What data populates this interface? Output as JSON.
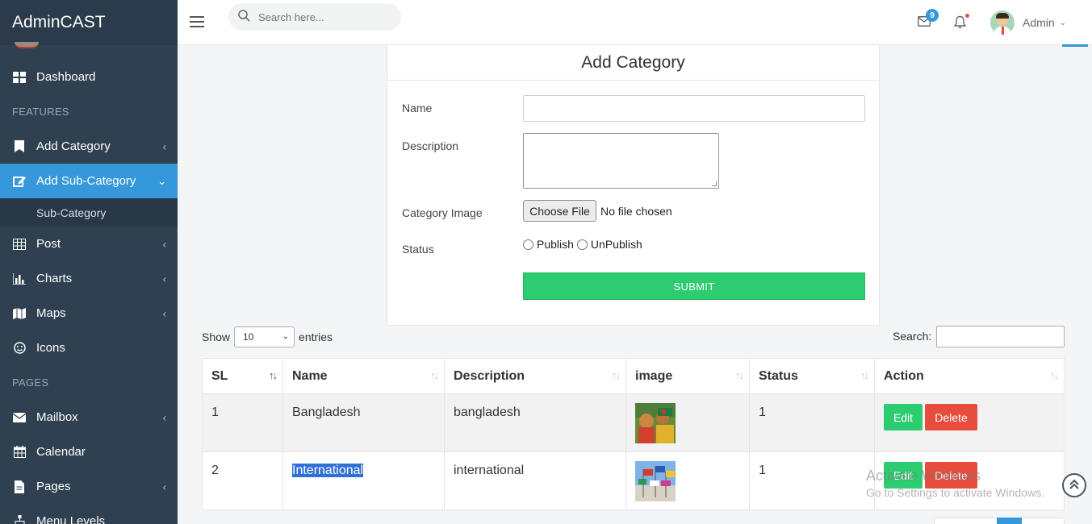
{
  "brand": {
    "title": "AdminCAST"
  },
  "sidebar": {
    "items": [
      {
        "label": "Dashboard"
      },
      {
        "section": "FEATURES"
      },
      {
        "label": "Add Category"
      },
      {
        "label": "Add Sub-Category",
        "sub": "Sub-Category"
      },
      {
        "label": "Post"
      },
      {
        "label": "Charts"
      },
      {
        "label": "Maps"
      },
      {
        "label": "Icons"
      },
      {
        "section": "PAGES"
      },
      {
        "label": "Mailbox"
      },
      {
        "label": "Calendar"
      },
      {
        "label": "Pages"
      },
      {
        "label": "Menu Levels"
      }
    ]
  },
  "header": {
    "search_placeholder": "Search here...",
    "mail_count": "9",
    "user_name": "Admin"
  },
  "form": {
    "title": "Add Category",
    "name_label": "Name",
    "description_label": "Description",
    "image_label": "Category Image",
    "file_button": "Choose File",
    "file_status": "No file chosen",
    "status_label": "Status",
    "status_options": [
      "Publish",
      "UnPublish"
    ],
    "submit_label": "SUBMIT"
  },
  "table_controls": {
    "show_label": "Show",
    "entries_value": "10",
    "entries_label": "entries",
    "search_label": "Search:"
  },
  "table": {
    "columns": [
      "SL",
      "Name",
      "Description",
      "image",
      "Status",
      "Action"
    ],
    "rows": [
      {
        "sl": "1",
        "name": "Bangladesh",
        "description": "bangladesh",
        "status": "1",
        "edit": "Edit",
        "delete": "Delete"
      },
      {
        "sl": "2",
        "name": "International",
        "description": "international",
        "status": "1",
        "edit": "Edit",
        "delete": "Delete"
      }
    ]
  },
  "watermark": {
    "title": "Activate Windows",
    "subtitle": "Go to Settings to activate Windows."
  },
  "colors": {
    "sidebar_bg": "#2f4050",
    "active_nav": "#3498db",
    "submit_green": "#2ecc71",
    "delete_red": "#e74c3c"
  }
}
